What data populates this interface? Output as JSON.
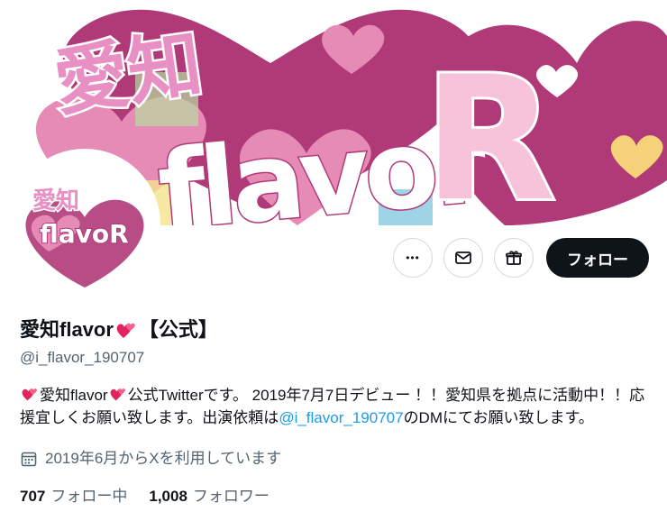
{
  "banner": {
    "title_jp": "愛知",
    "title_main": "flavor",
    "title_r": "R"
  },
  "avatar": {
    "title_jp": "愛知",
    "title_main": "flavoR"
  },
  "actions": {
    "more_label": "•••",
    "follow_label": "フォロー"
  },
  "profile": {
    "name_before": "愛知flavor",
    "name_after": "【公式】",
    "handle": "@i_flavor_190707"
  },
  "bio": {
    "part1": "愛知flavor",
    "part2": "公式Twitterです。 2019年7月7日デビュー ！！愛知県を拠点に活動中！！応援宜しくお願い致します。出演依頼は",
    "mention": "@i_flavor_190707",
    "part3": "のDMにてお願い致します。"
  },
  "joined": {
    "text": "2019年6月からXを利用しています"
  },
  "stats": {
    "following_count": "707",
    "following_label": "フォロー中",
    "followers_count": "1,008",
    "followers_label": "フォロワー"
  },
  "colors": {
    "magenta": "#b03a78",
    "pink": "#e68ab6",
    "light_pink": "#f6c3da",
    "link": "#1d9bf0",
    "text": "#0f1419",
    "secondary": "#536471"
  }
}
